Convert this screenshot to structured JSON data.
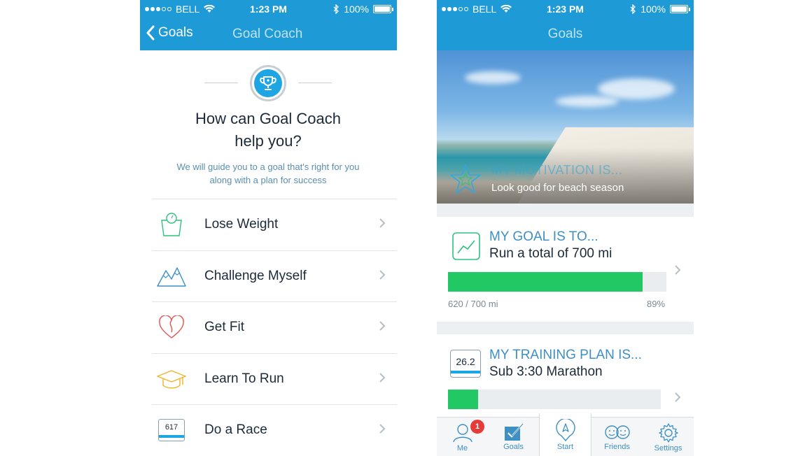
{
  "status_bar": {
    "carrier": "BELL",
    "time": "1:23 PM",
    "battery": "100%"
  },
  "left_screen": {
    "nav": {
      "back_label": "Goals",
      "title": "Goal Coach"
    },
    "title_line1": "How can Goal Coach",
    "title_line2": "help you?",
    "subtitle_line1": "We will guide you to a goal that's right for you",
    "subtitle_line2": "along with a plan for success",
    "options": [
      {
        "label": "Lose Weight",
        "icon": "scale-icon"
      },
      {
        "label": "Challenge Myself",
        "icon": "mountain-icon"
      },
      {
        "label": "Get Fit",
        "icon": "heart-icon"
      },
      {
        "label": "Learn To Run",
        "icon": "graduation-cap-icon"
      },
      {
        "label": "Do a Race",
        "icon": "race-bib-icon",
        "bib_number": "617"
      }
    ],
    "colors": {
      "nav": "#1e9ad6",
      "accent": "#1ea5e3"
    }
  },
  "right_screen": {
    "nav": {
      "title": "Goals"
    },
    "motivation": {
      "heading": "MY MOTIVATION IS...",
      "text": "Look good for beach season"
    },
    "goal": {
      "heading": "MY GOAL IS TO...",
      "text": "Run a total of 700 mi",
      "progress_text": "620 / 700 mi",
      "percent": "89%",
      "progress_fraction": 0.89
    },
    "plan": {
      "heading": "MY TRAINING PLAN IS...",
      "text": "Sub 3:30 Marathon",
      "bib_number": "26.2",
      "progress_fraction": 0.14
    },
    "tabs": [
      {
        "label": "Me",
        "badge": "1"
      },
      {
        "label": "Goals"
      },
      {
        "label": "Start"
      },
      {
        "label": "Friends"
      },
      {
        "label": "Settings"
      }
    ],
    "colors": {
      "progress": "#22c864",
      "heading": "#3d8fc4"
    }
  }
}
